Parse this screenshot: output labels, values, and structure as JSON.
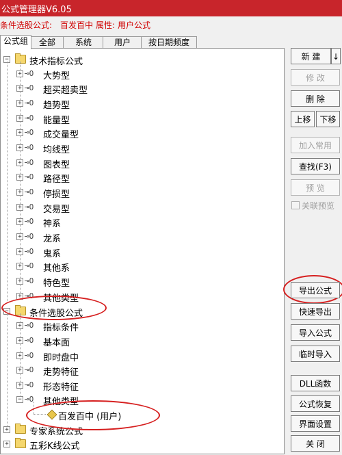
{
  "window": {
    "title": "公式管理器V6.05"
  },
  "info": {
    "condition_label": "条件选股公式:",
    "condition_value": "百发百中",
    "attr_label": "属性:",
    "attr_value": "用户公式"
  },
  "tabs": [
    "公式组",
    "全部",
    "系统",
    "用户",
    "按日期频度"
  ],
  "tree": {
    "group1": {
      "label": "技术指标公式",
      "children": [
        "大势型",
        "超买超卖型",
        "趋势型",
        "能量型",
        "成交量型",
        "均线型",
        "图表型",
        "路径型",
        "停损型",
        "交易型",
        "神系",
        "龙系",
        "鬼系",
        "其他系",
        "特色型",
        "其他类型"
      ]
    },
    "group2": {
      "label": "条件选股公式",
      "children": [
        "指标条件",
        "基本面",
        "即时盘中",
        "走势特征",
        "形态特征",
        "其他类型"
      ]
    },
    "leaf": {
      "label": "百发百中 (用户)"
    },
    "group3": {
      "label": "专家系统公式"
    },
    "group4": {
      "label": "五彩K线公式"
    }
  },
  "buttons": {
    "new": "新 建",
    "new_arrow": "↓",
    "modify": "修 改",
    "delete": "删 除",
    "move_up": "上移",
    "move_down": "下移",
    "add_common": "加入常用",
    "find": "查找(F3)",
    "preview": "预 览",
    "link_preview": "关联预览",
    "export": "导出公式",
    "quick_export": "快速导出",
    "import": "导入公式",
    "temp_import": "临时导入",
    "dll": "DLL函数",
    "restore": "公式恢复",
    "ui_settings": "界面设置",
    "close": "关 闭"
  }
}
